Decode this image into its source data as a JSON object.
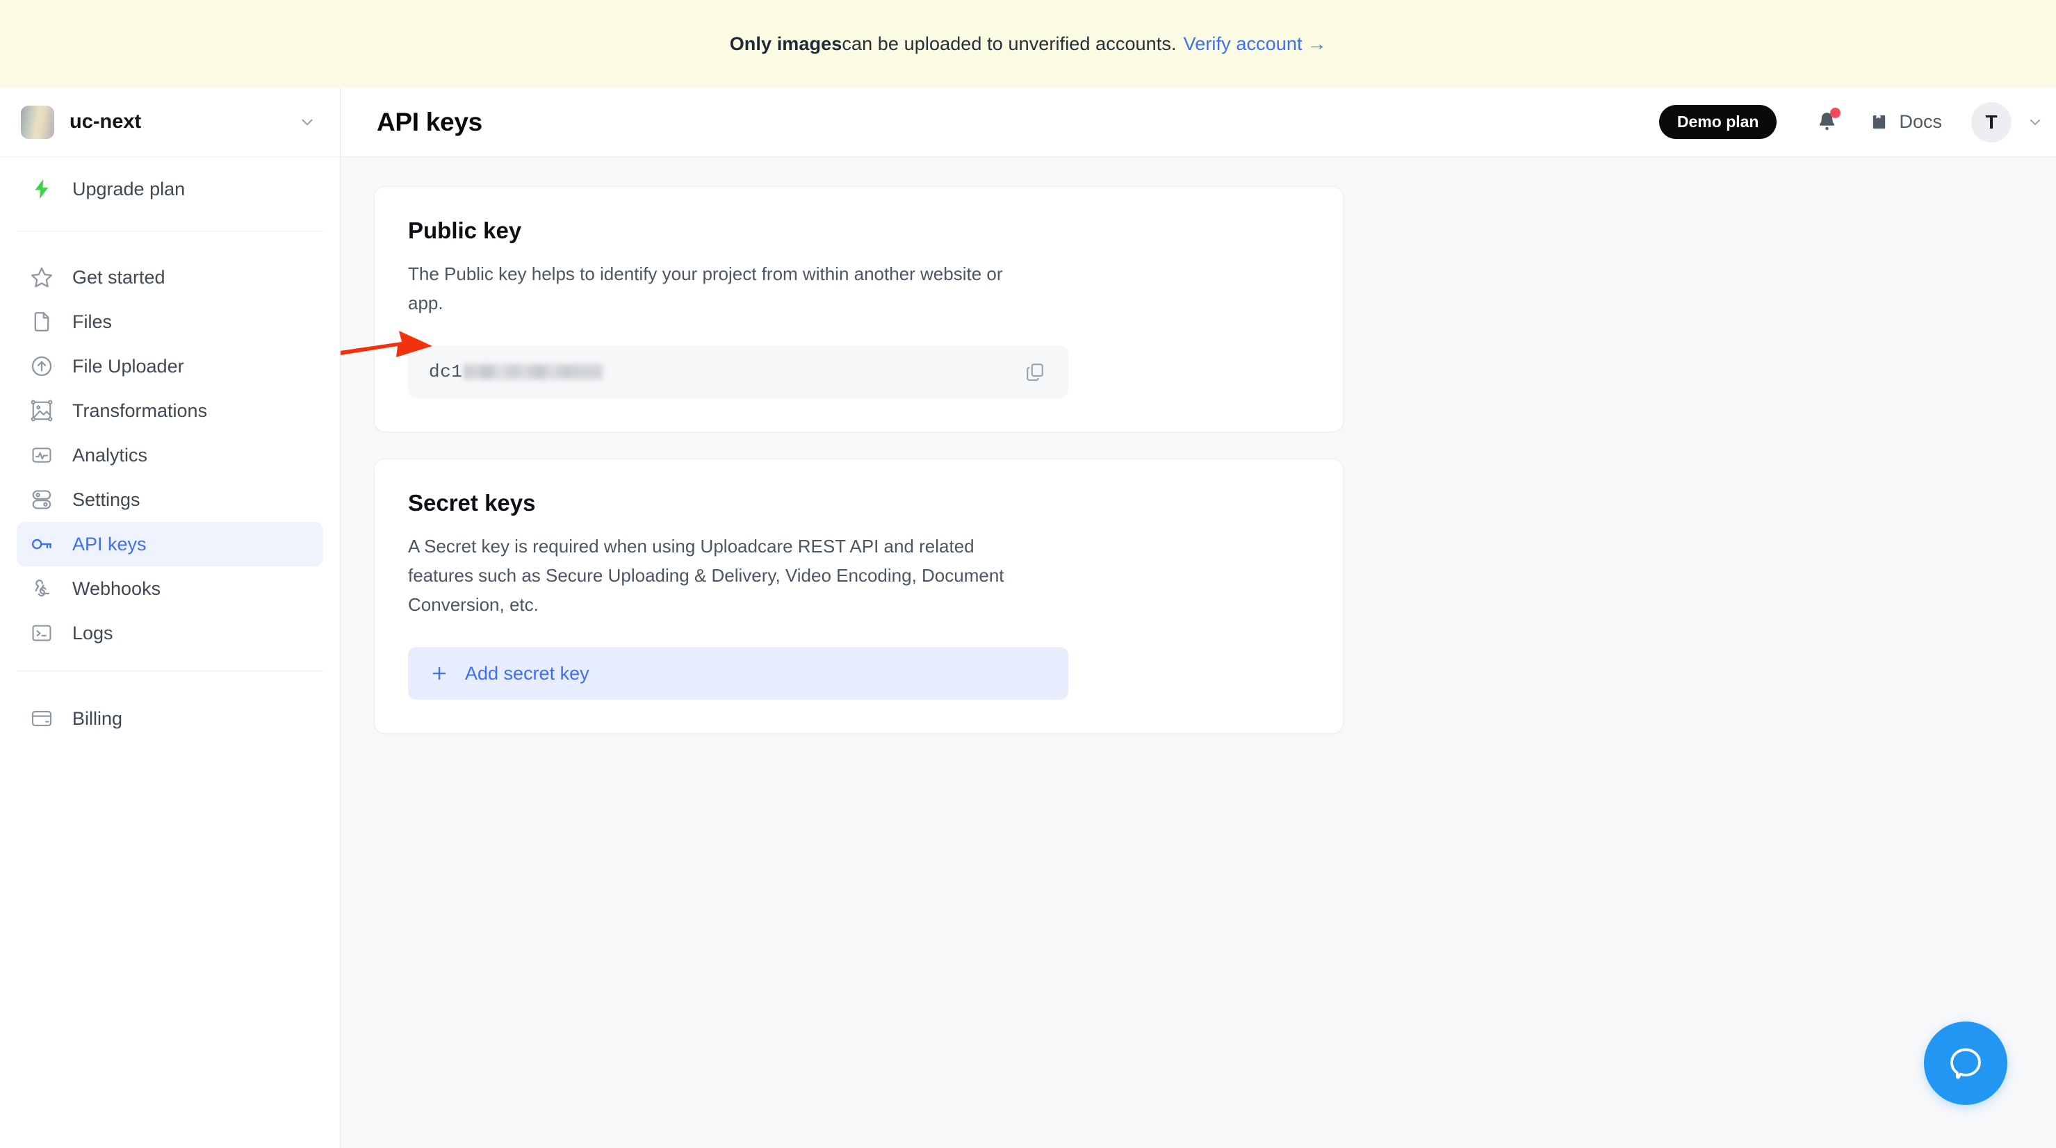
{
  "banner": {
    "strong": "Only images",
    "text": " can be uploaded to unverified accounts.",
    "link": "Verify account →",
    "background": "#fbfbe3",
    "link_color": "#3d6ff5"
  },
  "sidebar": {
    "project": {
      "name": "uc-next",
      "chevron_icon": "chevron-down-icon"
    },
    "upgrade": {
      "label": "Upgrade plan",
      "icon": "lightning-bolt-icon",
      "icon_color": "#3ed24a"
    },
    "items": [
      {
        "label": "Get started",
        "icon": "star-icon",
        "active": false
      },
      {
        "label": "Files",
        "icon": "file-icon",
        "active": false
      },
      {
        "label": "File Uploader",
        "icon": "upload-circle-icon",
        "active": false
      },
      {
        "label": "Transformations",
        "icon": "image-transform-icon",
        "active": false
      },
      {
        "label": "Analytics",
        "icon": "analytics-icon",
        "active": false
      },
      {
        "label": "Settings",
        "icon": "toggles-icon",
        "active": false
      },
      {
        "label": "API keys",
        "icon": "key-icon",
        "active": true
      },
      {
        "label": "Webhooks",
        "icon": "webhook-icon",
        "active": false
      },
      {
        "label": "Logs",
        "icon": "terminal-icon",
        "active": false
      }
    ],
    "footer_items": [
      {
        "label": "Billing",
        "icon": "credit-card-icon",
        "active": false
      }
    ],
    "active_color": "#3d6ff5",
    "active_background": "#eff3fd"
  },
  "topbar": {
    "title": "API keys",
    "plan_badge": "Demo plan",
    "notifications_icon": "bell-icon",
    "notifications_has_unread": true,
    "docs_label": "Docs",
    "docs_icon": "book-icon",
    "avatar_initial": "T",
    "avatar_chevron_icon": "chevron-down-icon"
  },
  "main": {
    "public_key_card": {
      "title": "Public key",
      "description": "The Public key helps to identify your project from within another website or app.",
      "key_prefix": "dc1",
      "key_redacted": true,
      "copy_icon": "copy-icon"
    },
    "secret_keys_card": {
      "title": "Secret keys",
      "description": "A Secret key is required when using Uploadcare REST API and related features such as Secure Uploading & Delivery, Video Encoding, Document Conversion, etc.",
      "add_button_label": "Add secret key",
      "add_button_icon": "plus-icon"
    }
  },
  "annotation": {
    "type": "arrow",
    "color": "#f4310d",
    "points_to": "public-key-field"
  },
  "help": {
    "icon": "chat-bubble-icon",
    "color": "#2196f3"
  }
}
